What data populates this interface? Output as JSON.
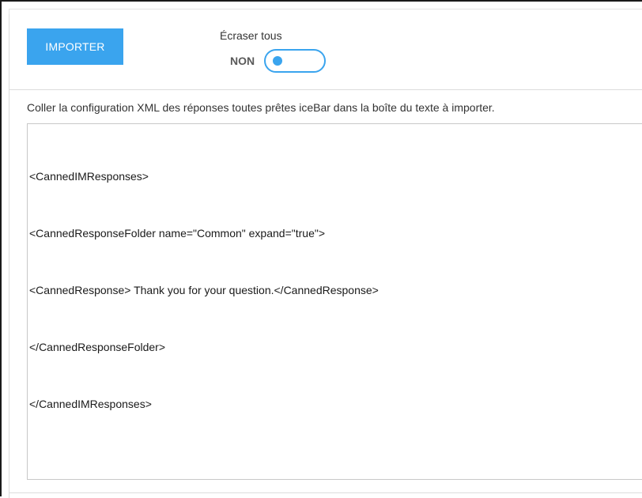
{
  "toolbar": {
    "import_label": "IMPORTER",
    "overwrite_label": "Écraser tous",
    "toggle_state_label": "NON",
    "toggle_on": false
  },
  "instructions": "Coller la configuration XML des réponses toutes prêtes iceBar dans la boîte du texte à importer.",
  "xml_content": {
    "lines": [
      "<CannedIMResponses>",
      "<CannedResponseFolder name=\"Common\" expand=\"true\">",
      "<CannedResponse> Thank you for your question.</CannedResponse>",
      "</CannedResponseFolder>",
      "</CannedIMResponses>"
    ]
  },
  "colors": {
    "accent": "#3aa4ee",
    "text": "#333333",
    "border": "#c8c8c8"
  }
}
